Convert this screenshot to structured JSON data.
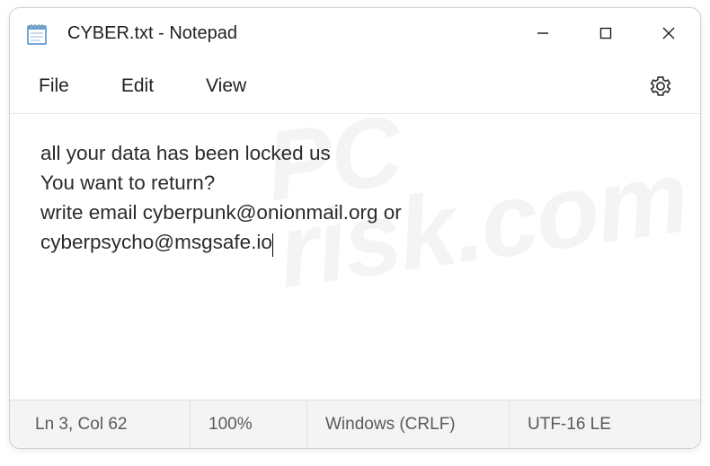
{
  "title": "CYBER.txt - Notepad",
  "menu": {
    "file": "File",
    "edit": "Edit",
    "view": "View"
  },
  "content": {
    "line1": "all your data has been locked us",
    "line2": "You want to return?",
    "line3": "write email cyberpunk@onionmail.org or",
    "line4": "cyberpsycho@msgsafe.io"
  },
  "status": {
    "position": "Ln 3, Col 62",
    "zoom": "100%",
    "eol": "Windows (CRLF)",
    "encoding": "UTF-16 LE"
  },
  "watermark": {
    "l1": "PC",
    "l2": "risk.com"
  }
}
